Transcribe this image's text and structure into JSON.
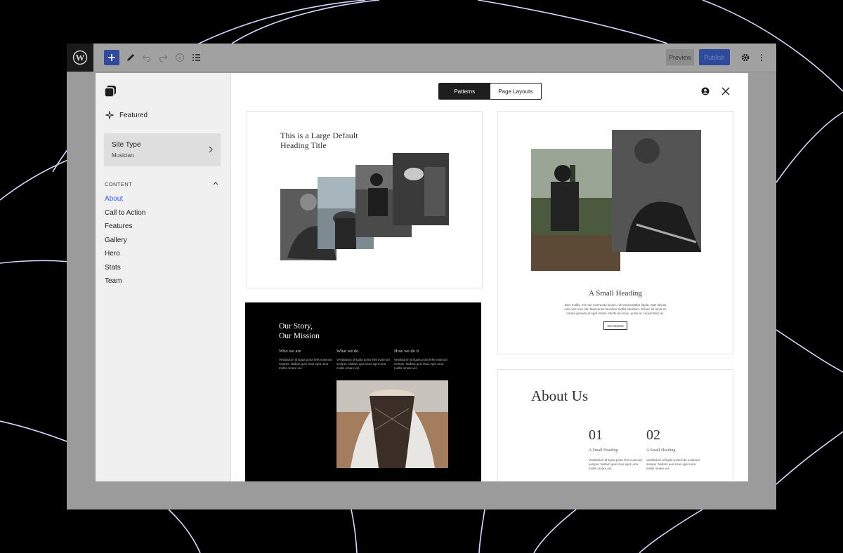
{
  "toolbar": {
    "logo_icon": "wordpress-logo",
    "add_icon": "plus-icon",
    "tools_icon": "pencil-icon",
    "undo_icon": "undo-icon",
    "redo_icon": "redo-icon",
    "details_icon": "info-icon",
    "list_view_icon": "list-view-icon",
    "preview_label": "Preview",
    "publish_label": "Publish",
    "settings_icon": "gear-icon",
    "options_icon": "more-vertical-icon"
  },
  "sidebar": {
    "featured_label": "Featured",
    "site_type": {
      "title": "Site Type",
      "value": "Musician"
    },
    "content_heading": "CONTENT",
    "categories": [
      {
        "label": "About",
        "active": true
      },
      {
        "label": "Call to Action",
        "active": false
      },
      {
        "label": "Features",
        "active": false
      },
      {
        "label": "Gallery",
        "active": false
      },
      {
        "label": "Hero",
        "active": false
      },
      {
        "label": "Stats",
        "active": false
      },
      {
        "label": "Team",
        "active": false
      }
    ]
  },
  "header": {
    "tabs": [
      {
        "label": "Patterns",
        "active": true
      },
      {
        "label": "Page Layouts",
        "active": false
      }
    ]
  },
  "patterns": {
    "gallery": {
      "heading_line1": "This is a Large Default",
      "heading_line2": "Heading Title"
    },
    "hero": {
      "heading": "A Small Heading",
      "body": "Duis mollis, est non commodo luctus, nisi erat porttitor ligula, eget lacinia odio sem nec elit. Maecenas faucibus mollis interdum. Donec sit amet mi ornare gravida at eget metus. Morbi leo risus, porta ac consectetur ac.",
      "button": "Get Started"
    },
    "story": {
      "heading_line1": "Our Story,",
      "heading_line2": "Our Mission",
      "columns": [
        {
          "title": "Who we are",
          "text": "Vestibulum id ligula porta felis euismod semper. Nullam quis risus eget urna mollis ornare vel."
        },
        {
          "title": "What we do",
          "text": "Vestibulum id ligula porta felis euismod semper. Nullam quis risus eget urna mollis ornare vel."
        },
        {
          "title": "How we do it",
          "text": "Vestibulum id ligula porta felis euismod semper. Nullam quis risus eget urna mollis ornare vel."
        }
      ]
    },
    "about": {
      "heading": "About Us",
      "items": [
        {
          "number": "01",
          "title": "A Small Heading",
          "text": "Vestibulum id ligula porta felis euismod semper. Nullam quis risus eget urna mollis ornare vel."
        },
        {
          "number": "02",
          "title": "A Small Heading",
          "text": "Vestibulum id ligula porta felis euismod semper. Nullam quis risus eget urna mollis ornare vel."
        }
      ]
    }
  },
  "colors": {
    "accent": "#3858e9",
    "overlay": "#9b9b9b",
    "background": "#000000"
  }
}
